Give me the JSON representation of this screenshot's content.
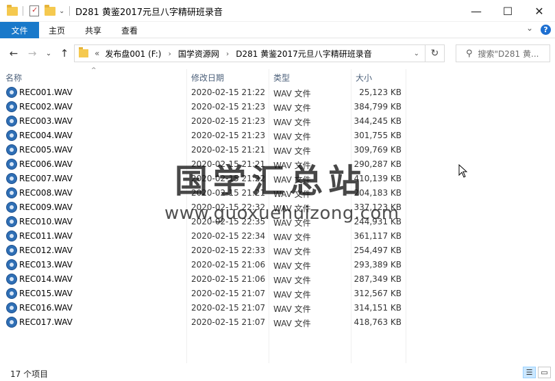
{
  "window": {
    "title": "D281 黄鉴2017元旦八字精研班录音",
    "minimize_glyph": "—",
    "maximize_glyph": "☐",
    "close_glyph": "✕"
  },
  "ribbon": {
    "tabs": [
      "文件",
      "主页",
      "共享",
      "查看"
    ],
    "expand_glyph": "⌄",
    "help_glyph": "?"
  },
  "nav": {
    "back_glyph": "←",
    "forward_glyph": "→",
    "recent_glyph": "⌄",
    "up_glyph": "↑",
    "overflow": "«",
    "breadcrumbs": [
      "发布盘001 (F:)",
      "国学资源网",
      "D281 黄鉴2017元旦八字精研班录音"
    ],
    "separator": "›",
    "dropdown_glyph": "⌄",
    "refresh_glyph": "↻",
    "search_placeholder": "搜索\"D281 黄...",
    "search_glyph": "⚲"
  },
  "columns": {
    "name": "名称",
    "date": "修改日期",
    "type": "类型",
    "size": "大小",
    "sort_glyph": "^"
  },
  "files": [
    {
      "name": "REC001.WAV",
      "date": "2020-02-15 21:22",
      "type": "WAV 文件",
      "size": "25,123 KB"
    },
    {
      "name": "REC002.WAV",
      "date": "2020-02-15 21:23",
      "type": "WAV 文件",
      "size": "384,799 KB"
    },
    {
      "name": "REC003.WAV",
      "date": "2020-02-15 21:23",
      "type": "WAV 文件",
      "size": "344,245 KB"
    },
    {
      "name": "REC004.WAV",
      "date": "2020-02-15 21:23",
      "type": "WAV 文件",
      "size": "301,755 KB"
    },
    {
      "name": "REC005.WAV",
      "date": "2020-02-15 21:21",
      "type": "WAV 文件",
      "size": "309,769 KB"
    },
    {
      "name": "REC006.WAV",
      "date": "2020-02-15 21:21",
      "type": "WAV 文件",
      "size": "290,287 KB"
    },
    {
      "name": "REC007.WAV",
      "date": "2020-02-15 21:22",
      "type": "WAV 文件",
      "size": "410,139 KB"
    },
    {
      "name": "REC008.WAV",
      "date": "2020-02-15 21:21",
      "type": "WAV 文件",
      "size": "204,183 KB"
    },
    {
      "name": "REC009.WAV",
      "date": "2020-02-15 22:32",
      "type": "WAV 文件",
      "size": "337,123 KB"
    },
    {
      "name": "REC010.WAV",
      "date": "2020-02-15 22:35",
      "type": "WAV 文件",
      "size": "244,931 KB"
    },
    {
      "name": "REC011.WAV",
      "date": "2020-02-15 22:34",
      "type": "WAV 文件",
      "size": "361,117 KB"
    },
    {
      "name": "REC012.WAV",
      "date": "2020-02-15 22:33",
      "type": "WAV 文件",
      "size": "254,497 KB"
    },
    {
      "name": "REC013.WAV",
      "date": "2020-02-15 21:06",
      "type": "WAV 文件",
      "size": "293,389 KB"
    },
    {
      "name": "REC014.WAV",
      "date": "2020-02-15 21:06",
      "type": "WAV 文件",
      "size": "287,349 KB"
    },
    {
      "name": "REC015.WAV",
      "date": "2020-02-15 21:07",
      "type": "WAV 文件",
      "size": "312,567 KB"
    },
    {
      "name": "REC016.WAV",
      "date": "2020-02-15 21:07",
      "type": "WAV 文件",
      "size": "314,151 KB"
    },
    {
      "name": "REC017.WAV",
      "date": "2020-02-15 21:07",
      "type": "WAV 文件",
      "size": "418,763 KB"
    }
  ],
  "watermark": {
    "chinese": "国学汇总站",
    "url": "www.guoxuehuizong.com"
  },
  "status": {
    "item_count": "17 个项目",
    "details_view_glyph": "☰",
    "tiles_view_glyph": "▭"
  },
  "colors": {
    "accent": "#1979ca",
    "header_text": "#4c607a"
  }
}
